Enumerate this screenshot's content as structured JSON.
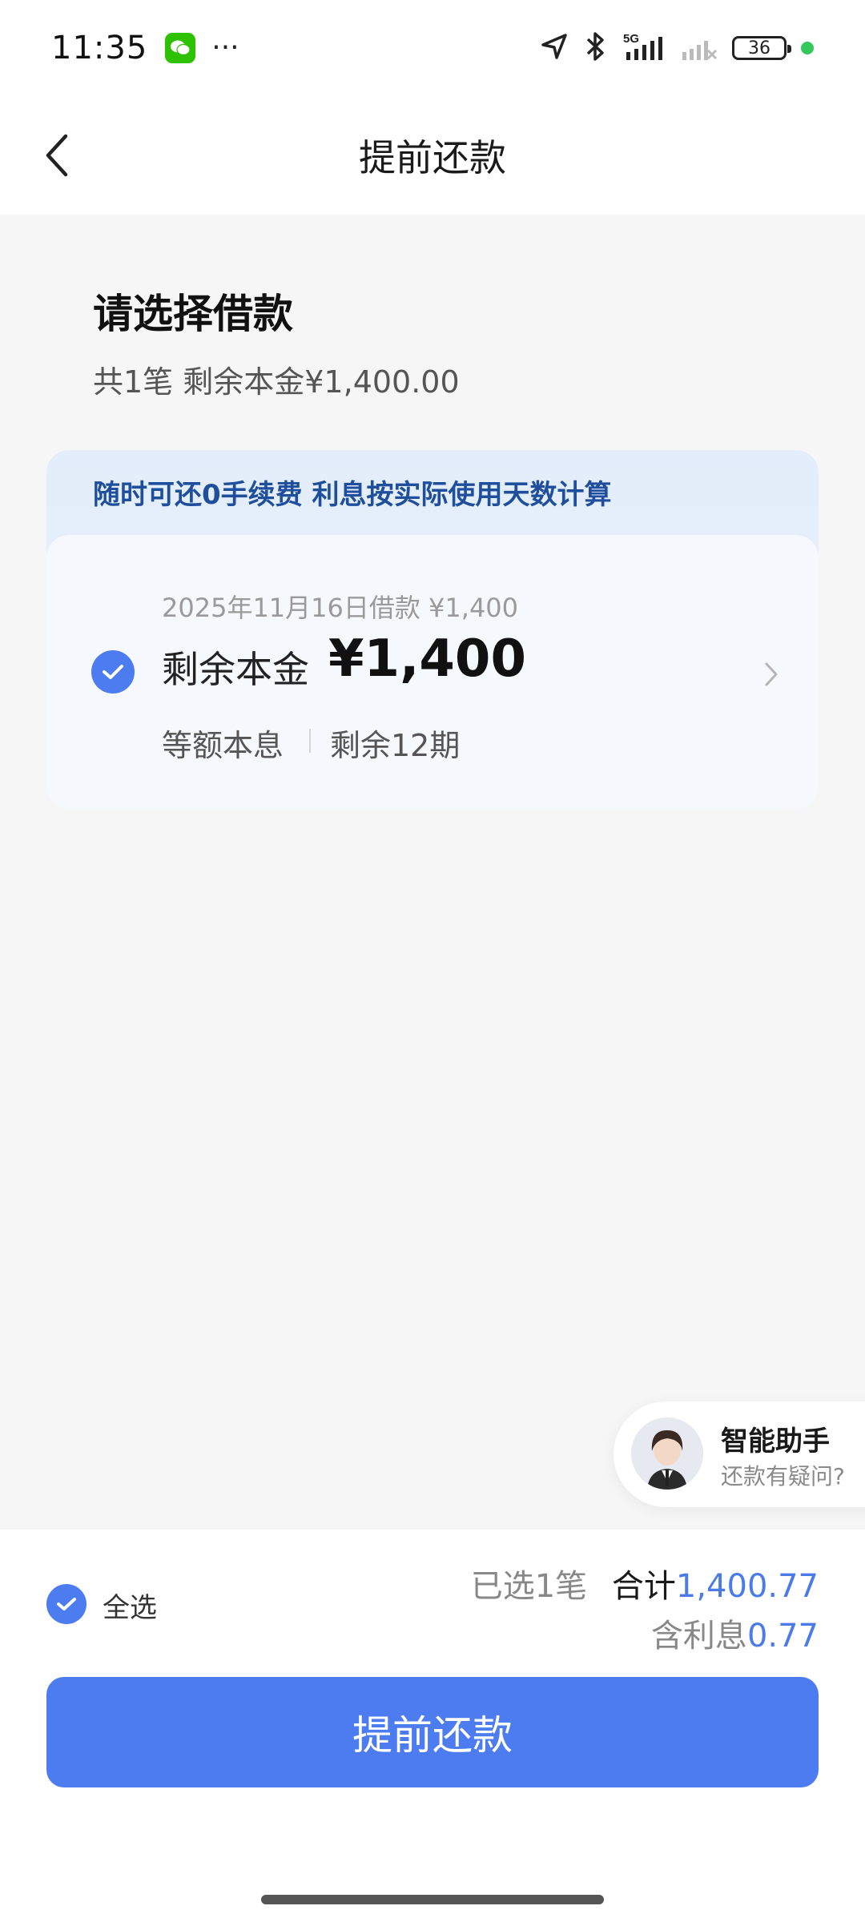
{
  "status_bar": {
    "time": "11:35",
    "battery": "36",
    "icons": [
      "wechat-icon",
      "more-dots-icon",
      "location-arrow-icon",
      "bluetooth-icon",
      "signal-5g-icon",
      "signal-icon",
      "battery-icon"
    ]
  },
  "nav": {
    "title": "提前还款",
    "back_icon": "chevron-left-icon"
  },
  "section": {
    "heading": "请选择借款",
    "summary": "共1笔 剩余本金¥1,400.00"
  },
  "loan_card": {
    "banner": "随时可还0手续费 利息按实际使用天数计算",
    "date_line": "2025年11月16日借款 ¥1,400",
    "principal_label": "剩余本金",
    "principal_amount": "¥1,400",
    "method": "等额本息",
    "remaining": "剩余12期",
    "selected": true
  },
  "assistant": {
    "title": "智能助手",
    "subtitle": "还款有疑问?"
  },
  "footer": {
    "select_all": "全选",
    "selected_count": "已选1笔",
    "total_label": "合计",
    "total_value": "1,400.77",
    "interest_label": "含利息",
    "interest_value": "0.77",
    "submit": "提前还款"
  },
  "colors": {
    "accent": "#4c7cf0",
    "banner_text": "#1f4f9c",
    "amount_blue": "#4a7be8"
  }
}
